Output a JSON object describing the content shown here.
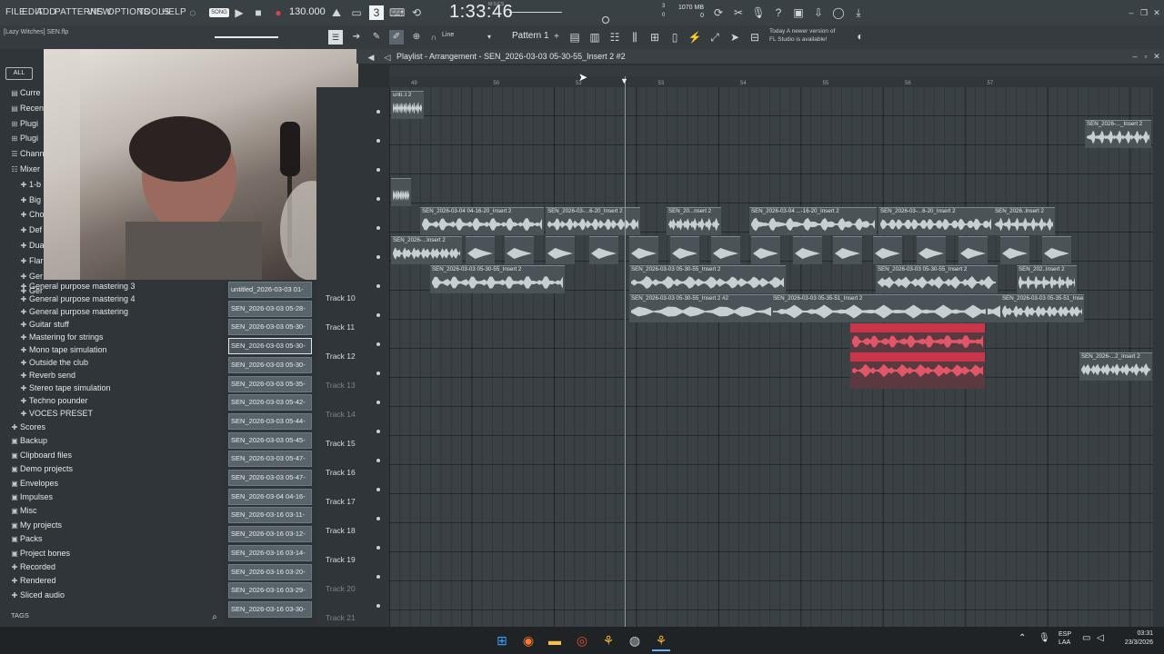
{
  "menubar": {
    "items": [
      "FILE",
      "EDIT",
      "ADD",
      "PATTERNS",
      "VIEW",
      "OPTIONS",
      "TOOLS",
      "HELP"
    ]
  },
  "transport": {
    "mode_label": "SONG",
    "tempo": "130.000",
    "clock": "1:33:46",
    "clock_sub": "M:S:CS",
    "memory": "1070 MB",
    "memory_sub": "0",
    "counter_top": "3",
    "counter_bottom": "0"
  },
  "project": {
    "name": "[Lazy Witches] SEN.flp"
  },
  "toolbar2": {
    "line_label": "Line",
    "pattern_label": "Pattern 1",
    "news_line1": "Today  A newer version of",
    "news_line2": "FL Studio is available!"
  },
  "browser": {
    "all_label": "ALL",
    "top_items": [
      "Curre",
      "Recen",
      "Plugi",
      "Plugi",
      "Chann",
      "Mixer",
      "1-b",
      "Big",
      "Cho",
      "Def",
      "Dua",
      "Flar",
      "Ger",
      "Ger"
    ],
    "presets": [
      "General purpose mastering 3",
      "General purpose mastering 4",
      "General purpose mastering",
      "Guitar stuff",
      "Mastering for strings",
      "Mono tape simulation",
      "Outside the club",
      "Reverb send",
      "Stereo tape simulation",
      "Techno pounder",
      "VOCES PRESET"
    ],
    "folders": [
      "Scores",
      "Backup",
      "Clipboard files",
      "Demo projects",
      "Envelopes",
      "Impulses",
      "Misc",
      "My projects",
      "Packs",
      "Project bones",
      "Recorded",
      "Rendered",
      "Sliced audio"
    ],
    "tags_label": "TAGS"
  },
  "clip_list": [
    "untitled_2026-03-03 01-",
    "SEN_2026-03-03 05-28-",
    "SEN_2026-03-03 05-30-",
    "SEN_2026-03-03 05-30-",
    "SEN_2026-03-03 05-30-",
    "SEN_2026-03-03 05-35-",
    "SEN_2026-03-03 05-42-",
    "SEN_2026-03-03 05-44-",
    "SEN_2026-03-03 05-45-",
    "SEN_2026-03-03 05-47-",
    "SEN_2026-03-03 05-47-",
    "SEN_2026-03-04 04-16-",
    "SEN_2026-03-16 03-11-",
    "SEN_2026-03-16 03-12-",
    "SEN_2026-03-16 03-14-",
    "SEN_2026-03-16 03-20-",
    "SEN_2026-03-16 03-29-",
    "SEN_2026-03-16 03-30-"
  ],
  "playlist": {
    "title": "Playlist - Arrangement - SEN_2026-03-03 05-30-55_Insert 2 #2",
    "ruler": [
      "49",
      "50",
      "52",
      "53",
      "54",
      "55",
      "56",
      "57"
    ],
    "tracks": [
      "Track 10",
      "Track 11",
      "Track 12",
      "Track 13",
      "Track 14",
      "Track 15",
      "Track 16",
      "Track 17",
      "Track 18",
      "Track 19",
      "Track 20",
      "Track 21"
    ],
    "clips": [
      {
        "label": "unti..t 2"
      },
      {
        "label": "SEN_2026-..._Insert 2"
      },
      {
        "label": ""
      },
      {
        "label": "SEN_2026-03-04 04-16-20_Insert 2"
      },
      {
        "label": "SEN_2026-03-...6-20_Insert 2"
      },
      {
        "label": "SEN_20...nsert 2"
      },
      {
        "label": "SEN_2026-03-04 ...-16-20_Insert 2"
      },
      {
        "label": "SEN_2026-03-...6-20_Insert 2"
      },
      {
        "label": "SEN_2026..Insert 2"
      },
      {
        "label": "SEN_2026-...Insert 2"
      },
      {
        "label": "SEN_2026-03-03 05-30-55_Insert 2"
      },
      {
        "label": "SEN_2026-03-03 05-30-55_Insert 2"
      },
      {
        "label": "SEN_2026-03-03 05-30-55_Insert 2"
      },
      {
        "label": "SEN_202..Insert 2"
      },
      {
        "label": "SEN_2026-03-03 05-30-55_Insert 2 #2"
      },
      {
        "label": "SEN_2026-03-03 05-35-51_Insert 2"
      },
      {
        "label": "SEN_2026-03-03 05-35-51_Insert 2"
      },
      {
        "label": "SEN_2026-03-03 05-30-55_Insert 2"
      },
      {
        "label": "SEN_2026-03-03 05-30-55_Insert 2 #2"
      },
      {
        "label": "SEN_2026-...2_Insert 2"
      }
    ]
  },
  "taskbar": {
    "lang": "ESP",
    "region": "LAA",
    "time": "03:31",
    "date": "23/3/2026"
  },
  "colors": {
    "accent_red": "#c9364a",
    "clip_grey": "#4a5358",
    "playlist_bg": "#3a4145"
  }
}
